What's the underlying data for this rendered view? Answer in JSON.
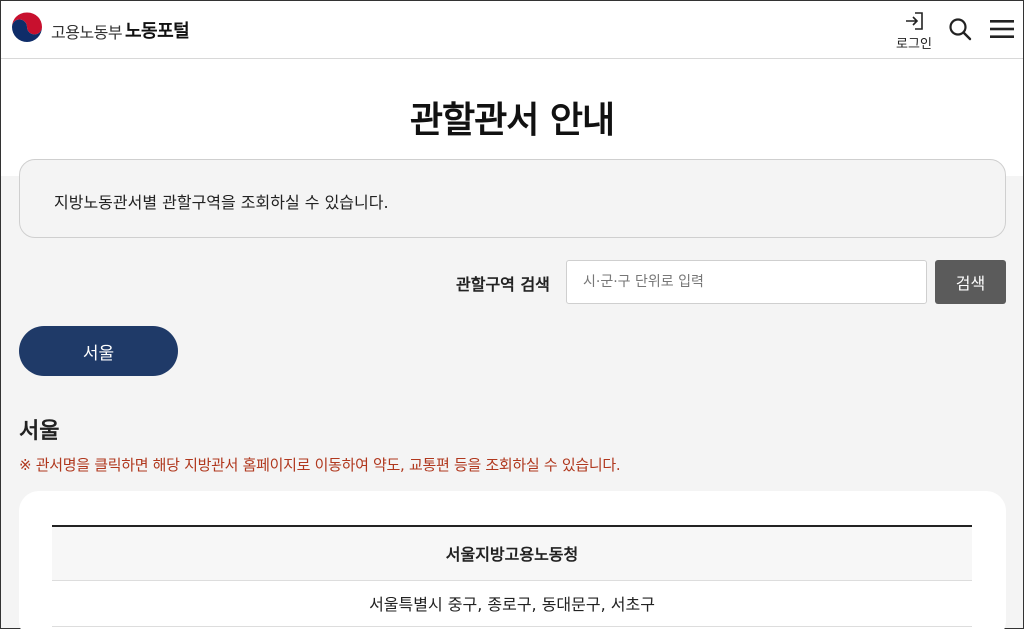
{
  "header": {
    "ministry_name": "고용노동부",
    "portal_name": "노동포털",
    "login_label": "로그인"
  },
  "page": {
    "title": "관할관서 안내",
    "info_text": "지방노동관서별 관할구역을 조회하실 수 있습니다."
  },
  "search": {
    "label": "관할구역 검색",
    "placeholder": "시·군·구 단위로 입력",
    "value": "",
    "button_label": "검색"
  },
  "region_tabs": [
    {
      "label": "서울",
      "active": true
    }
  ],
  "section": {
    "title": "서울",
    "notice": "※ 관서명을 클릭하면 해당 지방관서 홈페이지로 이동하여 약도, 교통편 등을 조회하실 수 있습니다."
  },
  "offices": [
    {
      "name": "서울지방고용노동청",
      "coverage": "서울특별시 중구, 종로구, 동대문구, 서초구"
    }
  ],
  "colors": {
    "region_tab_bg": "#1f3a68",
    "search_button_bg": "#5b5b5b",
    "notice_text": "#b0381e",
    "page_bg": "#f4f4f4"
  }
}
